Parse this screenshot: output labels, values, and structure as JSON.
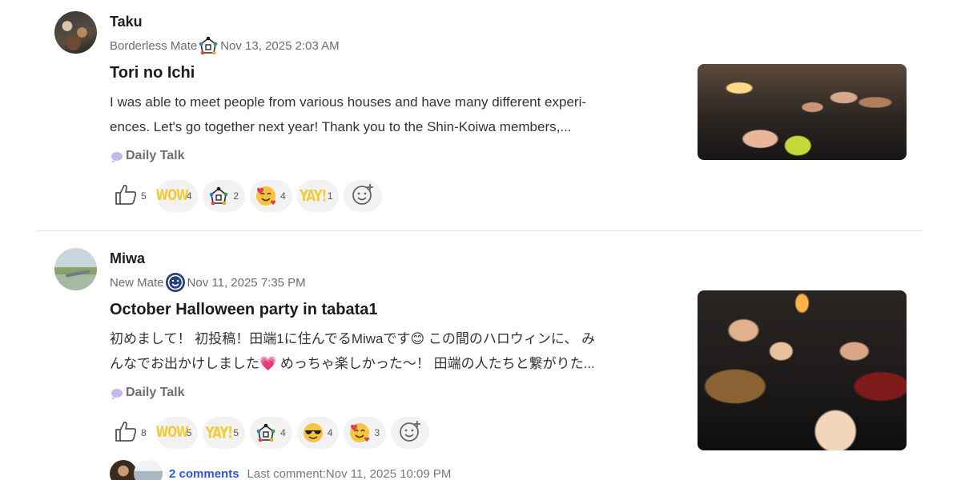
{
  "posts": [
    {
      "author": "Taku",
      "rank": "Borderless Mate",
      "rank_icon": "house-network-icon",
      "date": "Nov 13, 2025 2:03 AM",
      "title": "Tori no Ichi",
      "body_line1": "I was able to meet people from various houses and have many different experi-",
      "body_line2": "ences. Let's go together next year! Thank you to the Shin-Koiwa members,...",
      "tag": "Daily Talk",
      "reactions": {
        "like": "5",
        "wow_text": "WOW",
        "wow": "4",
        "network": "2",
        "love_face": "4",
        "yay_text": "YAY!",
        "yay": "1"
      }
    },
    {
      "author": "Miwa",
      "rank": "New Mate",
      "rank_icon": "smiley-badge-icon",
      "date": "Nov 11, 2025 7:35 PM",
      "title": "October Halloween party in tabata1",
      "body_line1": "初めまして！ 初投稿！田端1に住んでるMiwaです😊 この間のハロウィンに、 み",
      "body_line2": "んなでお出かけしました💗 めっちゃ楽しかった〜！ 田端の人たちと繋がりた...",
      "tag": "Daily Talk",
      "reactions": {
        "like": "8",
        "wow_text": "WOW",
        "wow": "5",
        "yay_text": "YAY!",
        "yay": "5",
        "network": "4",
        "cool": "4",
        "love_face": "3"
      },
      "comments": {
        "link": "2 comments",
        "last": "Last comment:Nov 11, 2025 10:09 PM"
      }
    }
  ],
  "colors": {
    "link": "#2f56d8",
    "meta": "#6c6c6c",
    "pill": "#f2f2f2",
    "accent_yellow": "#f1cc3a"
  }
}
